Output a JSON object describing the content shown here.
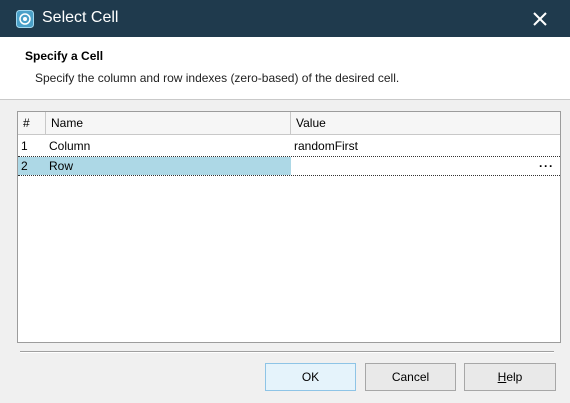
{
  "window": {
    "title": "Select Cell"
  },
  "header": {
    "title": "Specify a Cell",
    "description": "Specify the column and row indexes (zero-based) of the desired cell."
  },
  "table": {
    "columns": [
      "#",
      "Name",
      "Value"
    ],
    "rows": [
      {
        "num": "1",
        "name": "Column",
        "value": "randomFirst"
      },
      {
        "num": "2",
        "name": "Row",
        "value": ""
      }
    ],
    "ellipsis": "···"
  },
  "buttons": {
    "ok": "OK",
    "cancel": "Cancel",
    "help_first": "H",
    "help_rest": "elp"
  },
  "colors": {
    "titlebar": "#1f3a4d",
    "selection": "#add8e6",
    "primary_button": "#e5f3fb"
  }
}
